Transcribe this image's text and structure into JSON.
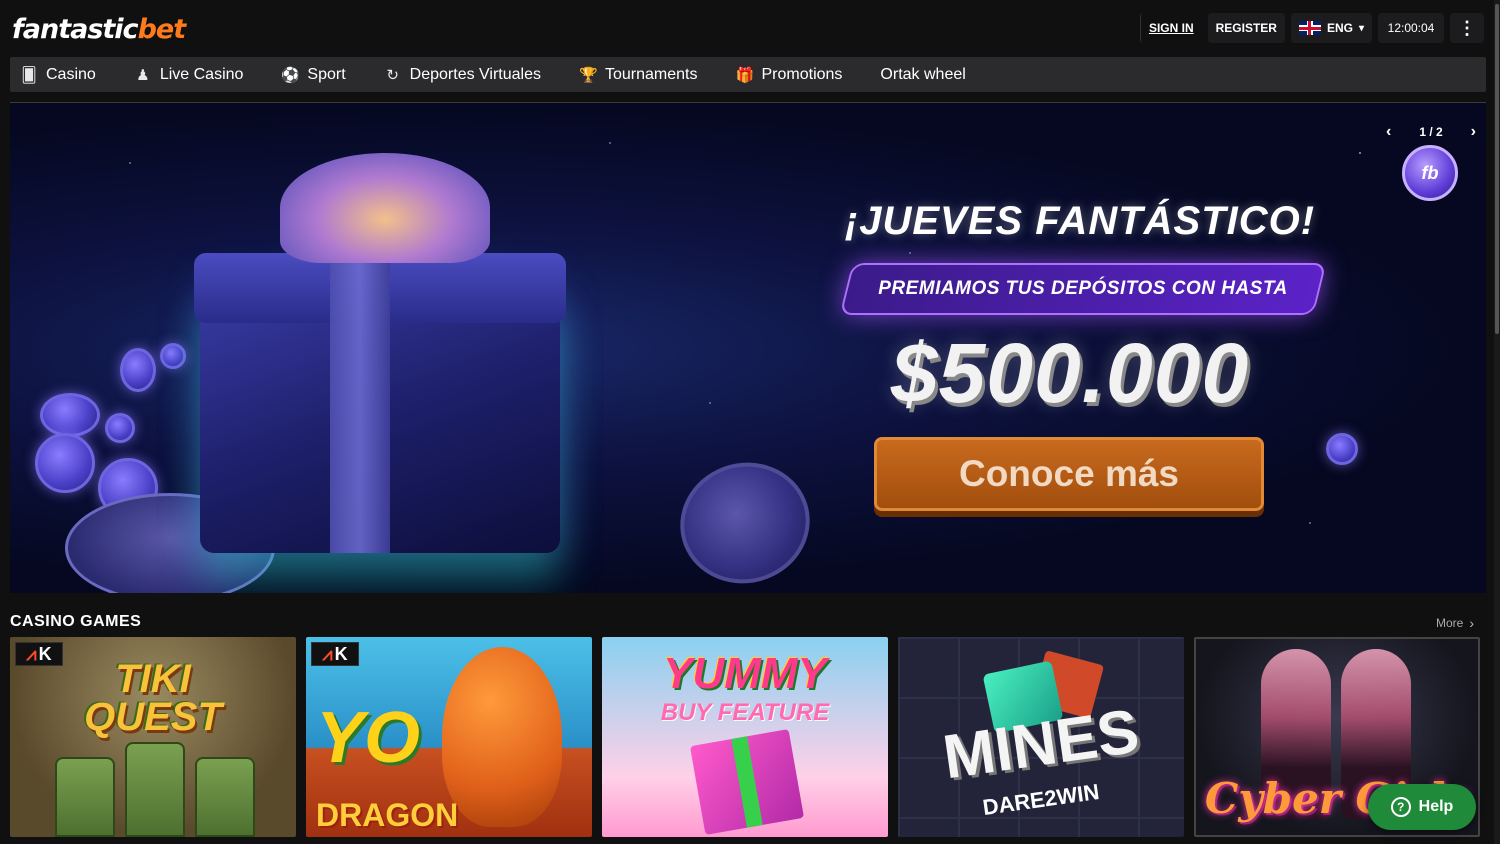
{
  "header": {
    "logo_main": "fantastic",
    "logo_accent": "bet",
    "sign_in": "SIGN IN",
    "register": "REGISTER",
    "language": "ENG",
    "clock": "12:00:04",
    "menu_icon": "kebab-vertical-icon"
  },
  "nav": {
    "items": [
      {
        "label": "Casino",
        "icon": "casino-cards-icon",
        "glyph": "🂠"
      },
      {
        "label": "Live Casino",
        "icon": "live-dealer-icon",
        "glyph": "♟"
      },
      {
        "label": "Sport",
        "icon": "soccer-ball-icon",
        "glyph": "⚽"
      },
      {
        "label": "Deportes Virtuales",
        "icon": "virtual-sports-icon",
        "glyph": "↻"
      },
      {
        "label": "Tournaments",
        "icon": "trophy-icon",
        "glyph": "🏆"
      },
      {
        "label": "Promotions",
        "icon": "gift-icon",
        "glyph": "🎁"
      },
      {
        "label": "Ortak wheel",
        "icon": "",
        "glyph": ""
      }
    ]
  },
  "banner": {
    "title": "¡JUEVES FANTÁSTICO!",
    "subtitle": "PREMIAMOS TUS DEPÓSITOS CON HASTA",
    "amount": "$500.000",
    "cta": "Conoce más",
    "slide_counter": "1 / 2",
    "coin_logo": "fb",
    "coin_text_big": "fb"
  },
  "casino_games": {
    "title": "CASINO GAMES",
    "more": "More",
    "games": [
      {
        "name": "TIKI QUEST",
        "line1": "TIKI",
        "line2": "QUEST",
        "provider_badge": "K"
      },
      {
        "name": "YO DRAGON",
        "line1": "YO",
        "line2": "DRAGON",
        "provider_badge": "K"
      },
      {
        "name": "YUMMY BUY FEATURE",
        "line1": "YUMMY",
        "line2": "BUY FEATURE"
      },
      {
        "name": "MINES DARE2WIN",
        "line1": "MINES",
        "line2": "DARE2WIN"
      },
      {
        "name": "Cyber Girls",
        "line1": "Cyber Girls"
      }
    ]
  },
  "help": {
    "label": "Help",
    "icon_glyph": "?"
  },
  "colors": {
    "brand_accent": "#ff7a1a",
    "background": "#101011",
    "nav_bg": "#2b2b2e",
    "help_green": "#1f8a3a",
    "cta_orange": "#c86a1e"
  }
}
